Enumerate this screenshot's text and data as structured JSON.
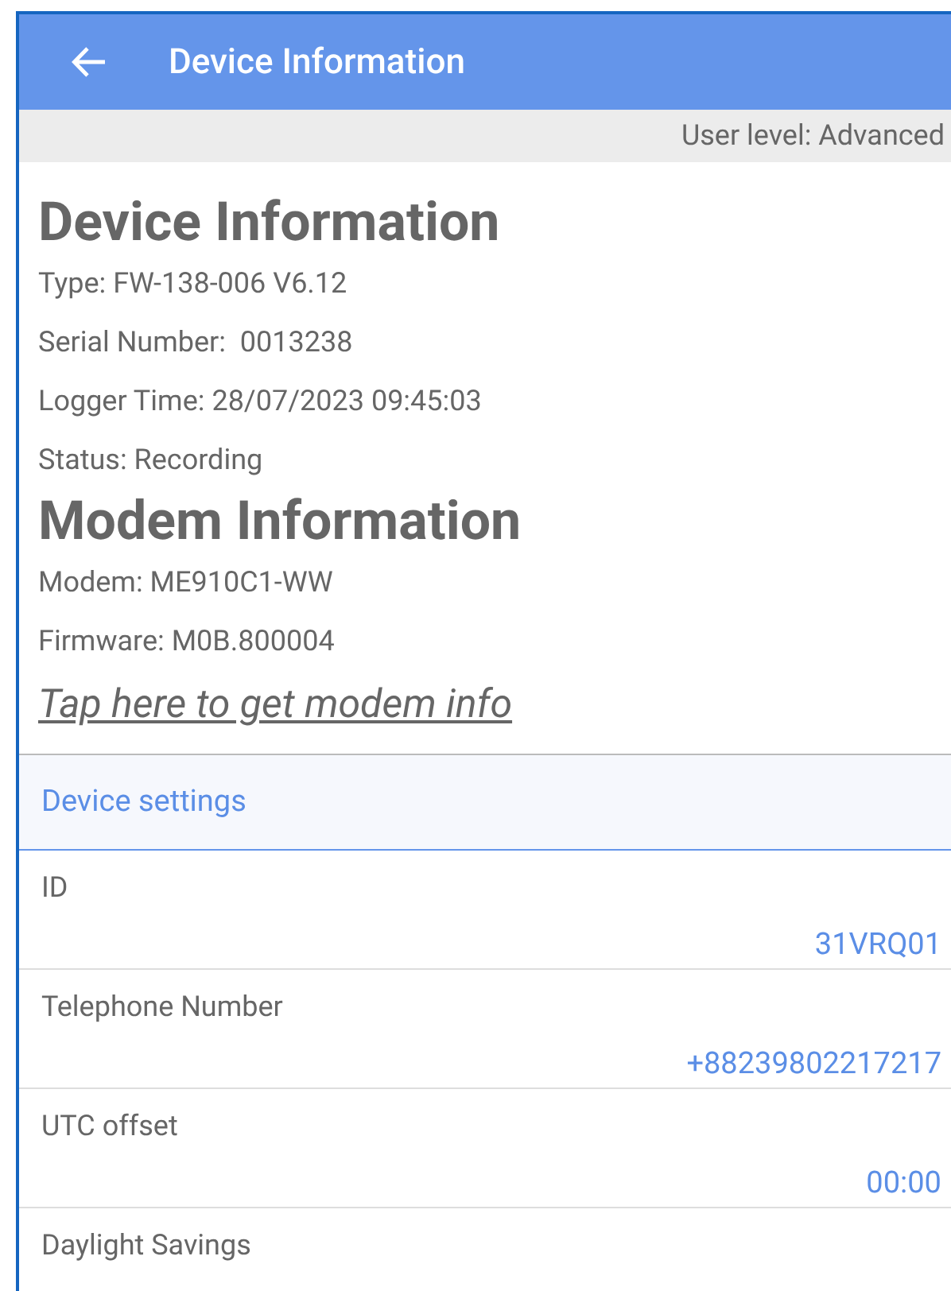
{
  "app_bar": {
    "title": "Device Information"
  },
  "user_level": "User level: Advanced",
  "device_info": {
    "heading": "Device Information",
    "lines": [
      "Type: FW-138-006 V6.12",
      "Serial Number:  0013238",
      "Logger Time: 28/07/2023 09:45:03",
      "Status: Recording"
    ]
  },
  "modem_info": {
    "heading": "Modem Information",
    "lines": [
      "Modem: ME910C1-WW",
      "Firmware: M0B.800004"
    ],
    "link": "Tap here to get modem info"
  },
  "settings": {
    "heading": "Device settings",
    "rows": [
      {
        "label": "ID",
        "value": "31VRQ01"
      },
      {
        "label": "Telephone Number",
        "value": "+88239802217217"
      },
      {
        "label": "UTC offset",
        "value": "00:00"
      },
      {
        "label": "Daylight Savings"
      }
    ]
  }
}
